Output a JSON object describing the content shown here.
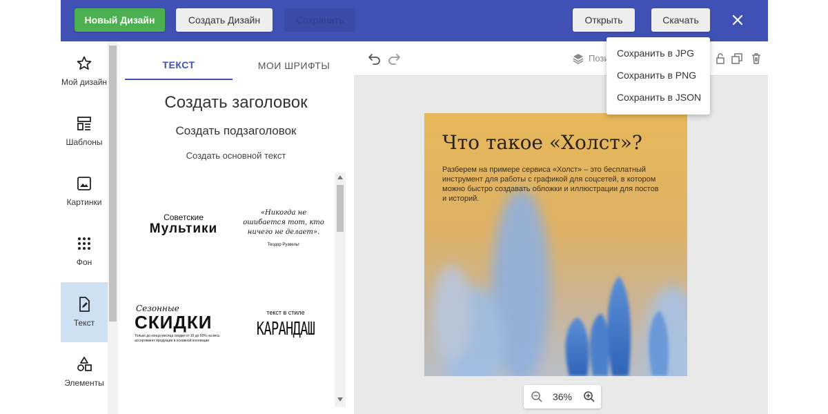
{
  "topbar": {
    "new_design": "Новый Дизайн",
    "create_design": "Создать Дизайн",
    "save": "Сохранить",
    "open": "Открыть",
    "download": "Скачать"
  },
  "sidebar": {
    "items": [
      {
        "label": "Мой дизайн",
        "icon": "star-icon"
      },
      {
        "label": "Шаблоны",
        "icon": "templates-icon"
      },
      {
        "label": "Картинки",
        "icon": "image-icon"
      },
      {
        "label": "Фон",
        "icon": "dots-grid-icon"
      },
      {
        "label": "Текст",
        "icon": "text-edit-icon"
      },
      {
        "label": "Элементы",
        "icon": "shapes-icon"
      }
    ]
  },
  "panel": {
    "tabs": [
      "ТЕКСТ",
      "МОИ ШРИФТЫ"
    ],
    "create_heading": "Создать заголовок",
    "create_subheading": "Создать подзаголовок",
    "create_body": "Создать основной текст",
    "templates": {
      "t1_small": "Советские",
      "t1_big": "Мультики",
      "t2_quote": "«Никогда не ошибается тот, кто ничего не делает».",
      "t2_author": "Теодор Рузвельт",
      "t3_script": "Сезонные",
      "t3_big": "СКИДКИ",
      "t3_small": "Только до конца месяца скидки от 10 до 60% на весь ассортимент продукции в основной коллекции",
      "t4_small": "текст в стиле",
      "t4_big": "КАРАНДАШ"
    }
  },
  "editor": {
    "position_label": "Пози",
    "design_title": "Что такое «Холст»?",
    "design_body": "Разберем на примере сервиса «Холст» – это бесплатный инструмент для работы с графикой для соцсетей, в котором можно быстро создавать обложки и иллюстрации для постов и историй.",
    "zoom": "36%"
  },
  "dropdown": {
    "items": [
      "Сохранить в JPG",
      "Сохранить в PNG",
      "Сохранить в JSON"
    ]
  },
  "colors": {
    "topbar": "#3f51b5",
    "green": "#4caf50",
    "active_sidebar": "#cfe0f2"
  }
}
